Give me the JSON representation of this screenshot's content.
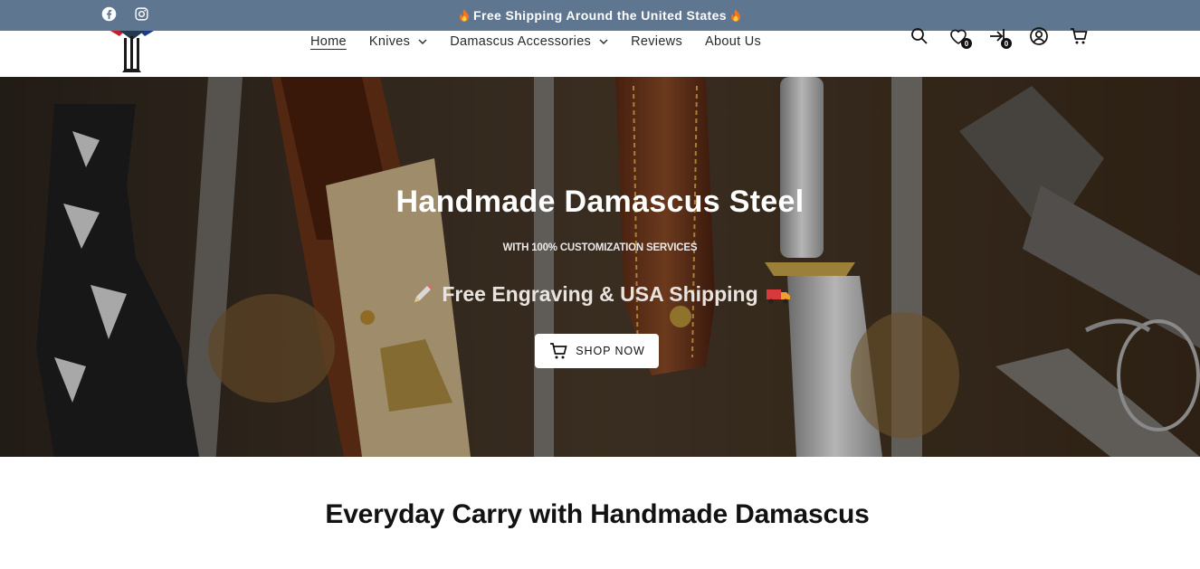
{
  "announcement": {
    "message": "Free Shipping Around the United States",
    "social": [
      "facebook-icon",
      "instagram-icon"
    ],
    "background": "#5f7690"
  },
  "nav": {
    "items": [
      {
        "label": "Home",
        "active": true,
        "dropdown": false
      },
      {
        "label": "Knives",
        "active": false,
        "dropdown": true
      },
      {
        "label": "Damascus Accessories",
        "active": false,
        "dropdown": true
      },
      {
        "label": "Reviews",
        "active": false,
        "dropdown": false
      },
      {
        "label": "About Us",
        "active": false,
        "dropdown": false
      }
    ]
  },
  "header_icons": {
    "wishlist_count": "0",
    "compare_count": "0",
    "icons": [
      "search-icon",
      "wishlist-icon",
      "compare-icon",
      "account-icon",
      "cart-icon"
    ]
  },
  "hero": {
    "title": "Handmade Damascus Steel",
    "subtitle": "WITH 100% CUSTOMIZATION SERVICES",
    "promo": "Free Engraving & USA Shipping",
    "cta_label": "SHOP NOW",
    "promo_icons": [
      "pencil-icon",
      "truck-icon"
    ]
  },
  "section": {
    "title": "Everyday Carry with Handmade Damascus"
  }
}
